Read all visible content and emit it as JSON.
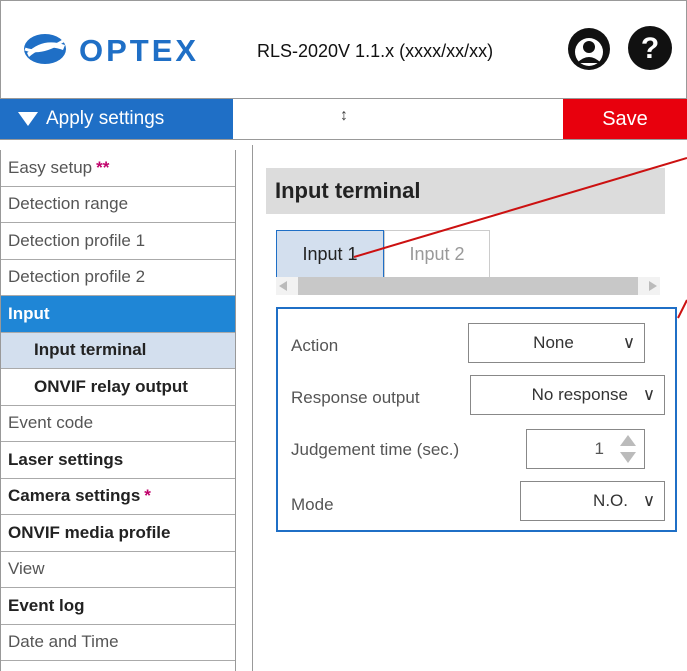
{
  "header": {
    "brand": "OPTEX",
    "title": "RLS-2020V 1.1.x (xxxx/xx/xx)"
  },
  "toolbar": {
    "apply_label": "Apply settings",
    "resize_glyph": "↕",
    "save_label": "Save"
  },
  "sidebar": {
    "items": [
      {
        "label": "Easy setup",
        "star": "**"
      },
      {
        "label": "Detection range"
      },
      {
        "label": "Detection profile 1"
      },
      {
        "label": "Detection profile 2"
      },
      {
        "label": "Input"
      },
      {
        "label": "Input terminal"
      },
      {
        "label": "ONVIF relay output"
      },
      {
        "label": "Event code"
      },
      {
        "label": "Laser settings"
      },
      {
        "label": "Camera settings",
        "star": "*"
      },
      {
        "label": "ONVIF media profile"
      },
      {
        "label": "View"
      },
      {
        "label": "Event log"
      },
      {
        "label": "Date and Time"
      }
    ]
  },
  "main": {
    "section_title": "Input terminal",
    "tabs": [
      {
        "label": "Input 1"
      },
      {
        "label": "Input 2"
      }
    ],
    "form": {
      "action": {
        "label": "Action",
        "value": "None"
      },
      "response_output": {
        "label": "Response output",
        "value": "No response"
      },
      "judgement_time": {
        "label": "Judgement time (sec.)",
        "value": "1"
      },
      "mode": {
        "label": "Mode",
        "value": "N.O."
      }
    }
  },
  "colors": {
    "accent_blue": "#1f6fc6",
    "sidebar_active": "#1f86d6",
    "save_red": "#e8000d",
    "callout_line": "#cc1111"
  },
  "icons": [
    "user-icon",
    "help-icon",
    "chevron-down-icon",
    "stepper-up-icon",
    "stepper-down-icon"
  ]
}
